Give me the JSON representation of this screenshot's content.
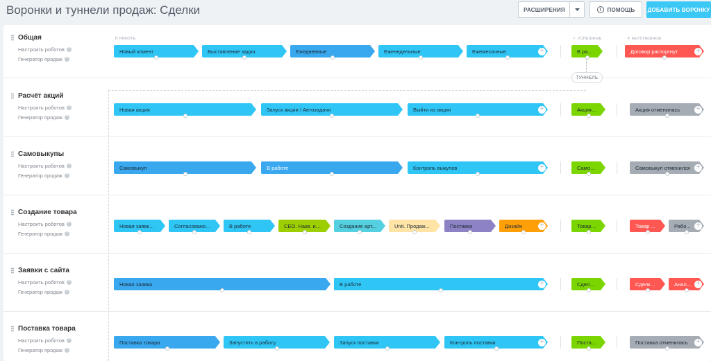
{
  "header": {
    "title": "Воронки и туннели продаж: Сделки",
    "btn_extensions": "РАСШИРЕНИЯ",
    "btn_help": "ПОМОЩЬ",
    "btn_add": "ДОБАВИТЬ ВОРОНКУ"
  },
  "columns": {
    "in_work": "В РАБОТЕ",
    "success": "✓ УСПЕШНЫЕ",
    "failed": "✕ НЕУСПЕШНЫЕ"
  },
  "tunnel_label": "ТУННЕЛЬ",
  "links": {
    "robots": "Настроить роботов",
    "generator": "Генератор продаж"
  },
  "icons": {
    "drag": "drag-handle-icon",
    "help": "help-icon",
    "dropdown": "chevron-down-icon",
    "add": "plus-icon"
  },
  "colors": {
    "accent": "#3bc8f5",
    "stage_cyan": "#2fc6f6",
    "stage_blue": "#39a8ef",
    "success_green": "#7bd500",
    "failed_red": "#ff5752",
    "failed_gray": "#a5acb4",
    "lime": "#9dcf00",
    "teal": "#55d0e0",
    "beige": "#ffe4a6",
    "purple": "#8c82c4",
    "orange": "#ff9f08"
  },
  "funnels": [
    {
      "name": "Общая",
      "stages": [
        {
          "label": "Новый клиент",
          "color": "#2fc6f6",
          "text": "#1e2b36"
        },
        {
          "label": "Выставление задач",
          "color": "#2fc6f6",
          "text": "#1e2b36"
        },
        {
          "label": "Ежедневные",
          "color": "#39a8ef",
          "text": "#1e2b36"
        },
        {
          "label": "Еженедельные",
          "color": "#2fc6f6",
          "text": "#1e2b36"
        },
        {
          "label": "Ежемесячные",
          "color": "#2fc6f6",
          "text": "#1e2b36"
        }
      ],
      "success": [
        {
          "label": "В работу",
          "color": "#7bd500",
          "text": "#1e2b36"
        }
      ],
      "failed": [
        {
          "label": "Договор расторгнут",
          "color": "#ff5752",
          "text": "#ffffff"
        }
      ]
    },
    {
      "name": "Расчёт акций",
      "stages": [
        {
          "label": "Новая акция",
          "color": "#2fc6f6",
          "text": "#1e2b36"
        },
        {
          "label": "Запуск акции / Автозадачи",
          "color": "#2fc6f6",
          "text": "#1e2b36"
        },
        {
          "label": "Выйти из акции",
          "color": "#2fc6f6",
          "text": "#1e2b36"
        }
      ],
      "success": [
        {
          "label": "Акция п...",
          "color": "#7bd500",
          "text": "#1e2b36"
        }
      ],
      "failed": [
        {
          "label": "Акция отменилась",
          "color": "#a5acb4",
          "text": "#1e2b36"
        }
      ]
    },
    {
      "name": "Самовыкупы",
      "stages": [
        {
          "label": "Самовыкуп",
          "color": "#39a8ef",
          "text": "#1e2b36"
        },
        {
          "label": "В работе",
          "color": "#39a8ef",
          "text": "#ffffff"
        },
        {
          "label": "Контроль выкупов",
          "color": "#2fc6f6",
          "text": "#1e2b36"
        }
      ],
      "success": [
        {
          "label": "Самовы...",
          "color": "#7bd500",
          "text": "#1e2b36"
        }
      ],
      "failed": [
        {
          "label": "Самовыкуп отменился",
          "color": "#a5acb4",
          "text": "#1e2b36"
        }
      ]
    },
    {
      "name": "Создание товара",
      "stages": [
        {
          "label": "Новая заявка ...",
          "color": "#2fc6f6",
          "text": "#1e2b36"
        },
        {
          "label": "Согласовано. ...",
          "color": "#2fc6f6",
          "text": "#1e2b36"
        },
        {
          "label": "В работе",
          "color": "#2fc6f6",
          "text": "#1e2b36"
        },
        {
          "label": "СЕО. Назв. и о...",
          "color": "#9dcf00",
          "text": "#1e2b36"
        },
        {
          "label": "Создание арт...",
          "color": "#55d0e0",
          "text": "#1e2b36"
        },
        {
          "label": "Unit. Продаж...",
          "color": "#ffe4a6",
          "text": "#1e2b36"
        },
        {
          "label": "Поставки",
          "color": "#8c82c4",
          "text": "#1e2b36"
        },
        {
          "label": "Дизайн",
          "color": "#ff9f08",
          "text": "#1e2b36"
        }
      ],
      "success": [
        {
          "label": "Товар за...",
          "color": "#7bd500",
          "text": "#1e2b36"
        }
      ],
      "failed": [
        {
          "label": "Товар ...",
          "color": "#ff5752",
          "text": "#ffffff"
        },
        {
          "label": "Рабо...",
          "color": "#a5acb4",
          "text": "#1e2b36"
        }
      ]
    },
    {
      "name": "Заявки с сайта",
      "stages": [
        {
          "label": "Новая заявка",
          "color": "#39a8ef",
          "text": "#1e2b36"
        },
        {
          "label": "В работе",
          "color": "#2fc6f6",
          "text": "#1e2b36"
        }
      ],
      "success": [
        {
          "label": "Сделка ...",
          "color": "#7bd500",
          "text": "#1e2b36"
        }
      ],
      "failed": [
        {
          "label": "Сделка ...",
          "color": "#ff5752",
          "text": "#ffffff"
        },
        {
          "label": "Анал...",
          "color": "#ff5752",
          "text": "#ffffff"
        }
      ]
    },
    {
      "name": "Поставка товара",
      "stages": [
        {
          "label": "Поставка товара",
          "color": "#39a8ef",
          "text": "#1e2b36"
        },
        {
          "label": "Запустить в работу",
          "color": "#2fc6f6",
          "text": "#1e2b36"
        },
        {
          "label": "Запуск поставки",
          "color": "#2fc6f6",
          "text": "#1e2b36"
        },
        {
          "label": "Контроль поставки",
          "color": "#2fc6f6",
          "text": "#1e2b36"
        }
      ],
      "success": [
        {
          "label": "Поставк...",
          "color": "#7bd500",
          "text": "#1e2b36"
        }
      ],
      "failed": [
        {
          "label": "Поставка отменилась",
          "color": "#a5acb4",
          "text": "#1e2b36"
        }
      ]
    }
  ]
}
